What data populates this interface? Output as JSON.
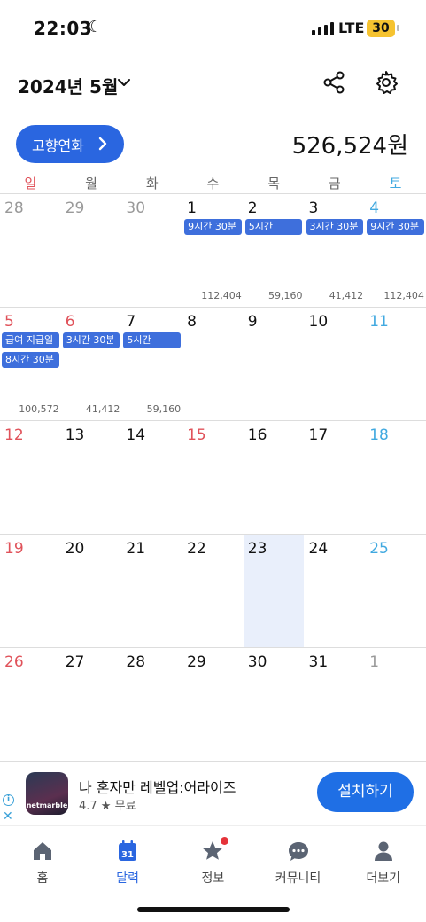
{
  "status_bar": {
    "time": "22:03",
    "network": "LTE",
    "battery": "30"
  },
  "header": {
    "month_title": "2024년 5월"
  },
  "donation": {
    "button_label": "고향연화",
    "total_amount": "526,524원"
  },
  "weekdays": [
    "일",
    "월",
    "화",
    "수",
    "목",
    "금",
    "토"
  ],
  "calendar": {
    "weeks": [
      {
        "days": [
          {
            "num": "28",
            "type": "sun other",
            "chips": [],
            "amount": ""
          },
          {
            "num": "29",
            "type": "other",
            "chips": [],
            "amount": ""
          },
          {
            "num": "30",
            "type": "other",
            "chips": [],
            "amount": ""
          },
          {
            "num": "1",
            "type": "",
            "chips": [
              "9시간 30분"
            ],
            "amount": "112,404"
          },
          {
            "num": "2",
            "type": "",
            "chips": [
              "5시간"
            ],
            "amount": "59,160"
          },
          {
            "num": "3",
            "type": "",
            "chips": [
              "3시간 30분"
            ],
            "amount": "41,412"
          },
          {
            "num": "4",
            "type": "sat",
            "chips": [
              "9시간 30분"
            ],
            "amount": "112,404"
          }
        ]
      },
      {
        "days": [
          {
            "num": "5",
            "type": "sun",
            "chips": [
              "급여 지급일",
              "8시간 30분"
            ],
            "amount": "100,572"
          },
          {
            "num": "6",
            "type": "sun",
            "chips": [
              "3시간 30분"
            ],
            "amount": "41,412"
          },
          {
            "num": "7",
            "type": "",
            "chips": [
              "5시간"
            ],
            "amount": "59,160"
          },
          {
            "num": "8",
            "type": "",
            "chips": [],
            "amount": ""
          },
          {
            "num": "9",
            "type": "",
            "chips": [],
            "amount": ""
          },
          {
            "num": "10",
            "type": "",
            "chips": [],
            "amount": ""
          },
          {
            "num": "11",
            "type": "sat",
            "chips": [],
            "amount": ""
          }
        ]
      },
      {
        "days": [
          {
            "num": "12",
            "type": "sun",
            "chips": [],
            "amount": ""
          },
          {
            "num": "13",
            "type": "",
            "chips": [],
            "amount": ""
          },
          {
            "num": "14",
            "type": "",
            "chips": [],
            "amount": ""
          },
          {
            "num": "15",
            "type": "sun",
            "chips": [],
            "amount": ""
          },
          {
            "num": "16",
            "type": "",
            "chips": [],
            "amount": ""
          },
          {
            "num": "17",
            "type": "",
            "chips": [],
            "amount": ""
          },
          {
            "num": "18",
            "type": "sat",
            "chips": [],
            "amount": ""
          }
        ]
      },
      {
        "days": [
          {
            "num": "19",
            "type": "sun",
            "chips": [],
            "amount": ""
          },
          {
            "num": "20",
            "type": "",
            "chips": [],
            "amount": ""
          },
          {
            "num": "21",
            "type": "",
            "chips": [],
            "amount": ""
          },
          {
            "num": "22",
            "type": "",
            "chips": [],
            "amount": ""
          },
          {
            "num": "23",
            "type": "today",
            "chips": [],
            "amount": ""
          },
          {
            "num": "24",
            "type": "",
            "chips": [],
            "amount": ""
          },
          {
            "num": "25",
            "type": "sat",
            "chips": [],
            "amount": ""
          }
        ]
      },
      {
        "days": [
          {
            "num": "26",
            "type": "sun",
            "chips": [],
            "amount": ""
          },
          {
            "num": "27",
            "type": "",
            "chips": [],
            "amount": ""
          },
          {
            "num": "28",
            "type": "",
            "chips": [],
            "amount": ""
          },
          {
            "num": "29",
            "type": "",
            "chips": [],
            "amount": ""
          },
          {
            "num": "30",
            "type": "",
            "chips": [],
            "amount": ""
          },
          {
            "num": "31",
            "type": "",
            "chips": [],
            "amount": ""
          },
          {
            "num": "1",
            "type": "other",
            "chips": [],
            "amount": ""
          }
        ]
      }
    ]
  },
  "ad": {
    "app_brand": "netmarble",
    "app_title": "나 혼자만 레벨업:어라이즈",
    "rating": "4.7 ★",
    "price": "무료",
    "install_label": "설치하기"
  },
  "tabbar": {
    "items": [
      {
        "label": "홈",
        "icon": "home-icon",
        "active": false
      },
      {
        "label": "달력",
        "icon": "calendar-icon",
        "active": true,
        "icon_text": "31"
      },
      {
        "label": "정보",
        "icon": "star-icon",
        "active": false,
        "badge": true
      },
      {
        "label": "커뮤니티",
        "icon": "chat-icon",
        "active": false
      },
      {
        "label": "더보기",
        "icon": "profile-icon",
        "active": false
      }
    ]
  },
  "colors": {
    "accent": "#2a66e0",
    "chip": "#3e6fdc",
    "sunday": "#e0525a",
    "saturday": "#41a9e0",
    "today_bg": "#e9effb"
  }
}
